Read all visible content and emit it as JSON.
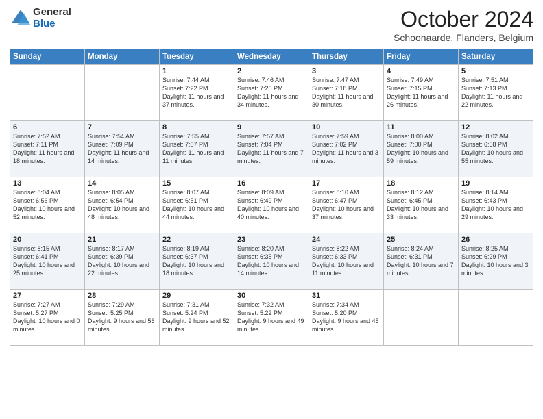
{
  "header": {
    "logo_general": "General",
    "logo_blue": "Blue",
    "month_title": "October 2024",
    "location": "Schoonaarde, Flanders, Belgium"
  },
  "weekdays": [
    "Sunday",
    "Monday",
    "Tuesday",
    "Wednesday",
    "Thursday",
    "Friday",
    "Saturday"
  ],
  "weeks": [
    [
      {
        "day": "",
        "sunrise": "",
        "sunset": "",
        "daylight": ""
      },
      {
        "day": "",
        "sunrise": "",
        "sunset": "",
        "daylight": ""
      },
      {
        "day": "1",
        "sunrise": "Sunrise: 7:44 AM",
        "sunset": "Sunset: 7:22 PM",
        "daylight": "Daylight: 11 hours and 37 minutes."
      },
      {
        "day": "2",
        "sunrise": "Sunrise: 7:46 AM",
        "sunset": "Sunset: 7:20 PM",
        "daylight": "Daylight: 11 hours and 34 minutes."
      },
      {
        "day": "3",
        "sunrise": "Sunrise: 7:47 AM",
        "sunset": "Sunset: 7:18 PM",
        "daylight": "Daylight: 11 hours and 30 minutes."
      },
      {
        "day": "4",
        "sunrise": "Sunrise: 7:49 AM",
        "sunset": "Sunset: 7:15 PM",
        "daylight": "Daylight: 11 hours and 26 minutes."
      },
      {
        "day": "5",
        "sunrise": "Sunrise: 7:51 AM",
        "sunset": "Sunset: 7:13 PM",
        "daylight": "Daylight: 11 hours and 22 minutes."
      }
    ],
    [
      {
        "day": "6",
        "sunrise": "Sunrise: 7:52 AM",
        "sunset": "Sunset: 7:11 PM",
        "daylight": "Daylight: 11 hours and 18 minutes."
      },
      {
        "day": "7",
        "sunrise": "Sunrise: 7:54 AM",
        "sunset": "Sunset: 7:09 PM",
        "daylight": "Daylight: 11 hours and 14 minutes."
      },
      {
        "day": "8",
        "sunrise": "Sunrise: 7:55 AM",
        "sunset": "Sunset: 7:07 PM",
        "daylight": "Daylight: 11 hours and 11 minutes."
      },
      {
        "day": "9",
        "sunrise": "Sunrise: 7:57 AM",
        "sunset": "Sunset: 7:04 PM",
        "daylight": "Daylight: 11 hours and 7 minutes."
      },
      {
        "day": "10",
        "sunrise": "Sunrise: 7:59 AM",
        "sunset": "Sunset: 7:02 PM",
        "daylight": "Daylight: 11 hours and 3 minutes."
      },
      {
        "day": "11",
        "sunrise": "Sunrise: 8:00 AM",
        "sunset": "Sunset: 7:00 PM",
        "daylight": "Daylight: 10 hours and 59 minutes."
      },
      {
        "day": "12",
        "sunrise": "Sunrise: 8:02 AM",
        "sunset": "Sunset: 6:58 PM",
        "daylight": "Daylight: 10 hours and 55 minutes."
      }
    ],
    [
      {
        "day": "13",
        "sunrise": "Sunrise: 8:04 AM",
        "sunset": "Sunset: 6:56 PM",
        "daylight": "Daylight: 10 hours and 52 minutes."
      },
      {
        "day": "14",
        "sunrise": "Sunrise: 8:05 AM",
        "sunset": "Sunset: 6:54 PM",
        "daylight": "Daylight: 10 hours and 48 minutes."
      },
      {
        "day": "15",
        "sunrise": "Sunrise: 8:07 AM",
        "sunset": "Sunset: 6:51 PM",
        "daylight": "Daylight: 10 hours and 44 minutes."
      },
      {
        "day": "16",
        "sunrise": "Sunrise: 8:09 AM",
        "sunset": "Sunset: 6:49 PM",
        "daylight": "Daylight: 10 hours and 40 minutes."
      },
      {
        "day": "17",
        "sunrise": "Sunrise: 8:10 AM",
        "sunset": "Sunset: 6:47 PM",
        "daylight": "Daylight: 10 hours and 37 minutes."
      },
      {
        "day": "18",
        "sunrise": "Sunrise: 8:12 AM",
        "sunset": "Sunset: 6:45 PM",
        "daylight": "Daylight: 10 hours and 33 minutes."
      },
      {
        "day": "19",
        "sunrise": "Sunrise: 8:14 AM",
        "sunset": "Sunset: 6:43 PM",
        "daylight": "Daylight: 10 hours and 29 minutes."
      }
    ],
    [
      {
        "day": "20",
        "sunrise": "Sunrise: 8:15 AM",
        "sunset": "Sunset: 6:41 PM",
        "daylight": "Daylight: 10 hours and 25 minutes."
      },
      {
        "day": "21",
        "sunrise": "Sunrise: 8:17 AM",
        "sunset": "Sunset: 6:39 PM",
        "daylight": "Daylight: 10 hours and 22 minutes."
      },
      {
        "day": "22",
        "sunrise": "Sunrise: 8:19 AM",
        "sunset": "Sunset: 6:37 PM",
        "daylight": "Daylight: 10 hours and 18 minutes."
      },
      {
        "day": "23",
        "sunrise": "Sunrise: 8:20 AM",
        "sunset": "Sunset: 6:35 PM",
        "daylight": "Daylight: 10 hours and 14 minutes."
      },
      {
        "day": "24",
        "sunrise": "Sunrise: 8:22 AM",
        "sunset": "Sunset: 6:33 PM",
        "daylight": "Daylight: 10 hours and 11 minutes."
      },
      {
        "day": "25",
        "sunrise": "Sunrise: 8:24 AM",
        "sunset": "Sunset: 6:31 PM",
        "daylight": "Daylight: 10 hours and 7 minutes."
      },
      {
        "day": "26",
        "sunrise": "Sunrise: 8:25 AM",
        "sunset": "Sunset: 6:29 PM",
        "daylight": "Daylight: 10 hours and 3 minutes."
      }
    ],
    [
      {
        "day": "27",
        "sunrise": "Sunrise: 7:27 AM",
        "sunset": "Sunset: 5:27 PM",
        "daylight": "Daylight: 10 hours and 0 minutes."
      },
      {
        "day": "28",
        "sunrise": "Sunrise: 7:29 AM",
        "sunset": "Sunset: 5:25 PM",
        "daylight": "Daylight: 9 hours and 56 minutes."
      },
      {
        "day": "29",
        "sunrise": "Sunrise: 7:31 AM",
        "sunset": "Sunset: 5:24 PM",
        "daylight": "Daylight: 9 hours and 52 minutes."
      },
      {
        "day": "30",
        "sunrise": "Sunrise: 7:32 AM",
        "sunset": "Sunset: 5:22 PM",
        "daylight": "Daylight: 9 hours and 49 minutes."
      },
      {
        "day": "31",
        "sunrise": "Sunrise: 7:34 AM",
        "sunset": "Sunset: 5:20 PM",
        "daylight": "Daylight: 9 hours and 45 minutes."
      },
      {
        "day": "",
        "sunrise": "",
        "sunset": "",
        "daylight": ""
      },
      {
        "day": "",
        "sunrise": "",
        "sunset": "",
        "daylight": ""
      }
    ]
  ]
}
